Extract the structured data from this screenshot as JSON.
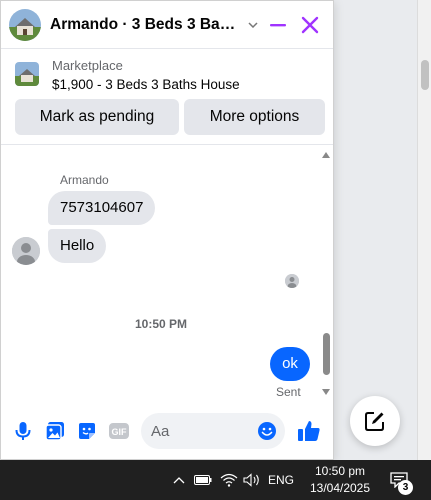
{
  "chat": {
    "title": "Armando · 3 Beds 3 Baths House",
    "title_display": "Armando · 3 Beds 3 Baths ...",
    "accent_color": "#a033ff",
    "marketplace": {
      "label": "Marketplace",
      "item": "$1,900 - 3 Beds 3 Baths House",
      "buttons": [
        "Mark as pending",
        "More options"
      ]
    },
    "messages": {
      "sender_name": "Armando",
      "incoming": [
        "7573104607",
        "Hello"
      ],
      "timestamp": "10:50 PM",
      "outgoing": "ok",
      "status": "Sent"
    },
    "composer": {
      "placeholder": "Aa",
      "gif_label": "GIF",
      "icons": [
        "microphone-icon",
        "photo-icon",
        "sticker-icon",
        "gif-icon",
        "emoji-icon",
        "thumbs-up-icon"
      ]
    }
  },
  "taskbar": {
    "language": "ENG",
    "time": "10:50 pm",
    "date": "13/04/2025",
    "notification_count": "3",
    "icons": [
      "chevron-up-icon",
      "battery-icon",
      "wifi-icon",
      "volume-icon",
      "notification-icon"
    ]
  },
  "colors": {
    "brand_blue": "#0866ff",
    "bubble_gray": "#e4e6eb",
    "taskbar_bg": "#202020"
  }
}
